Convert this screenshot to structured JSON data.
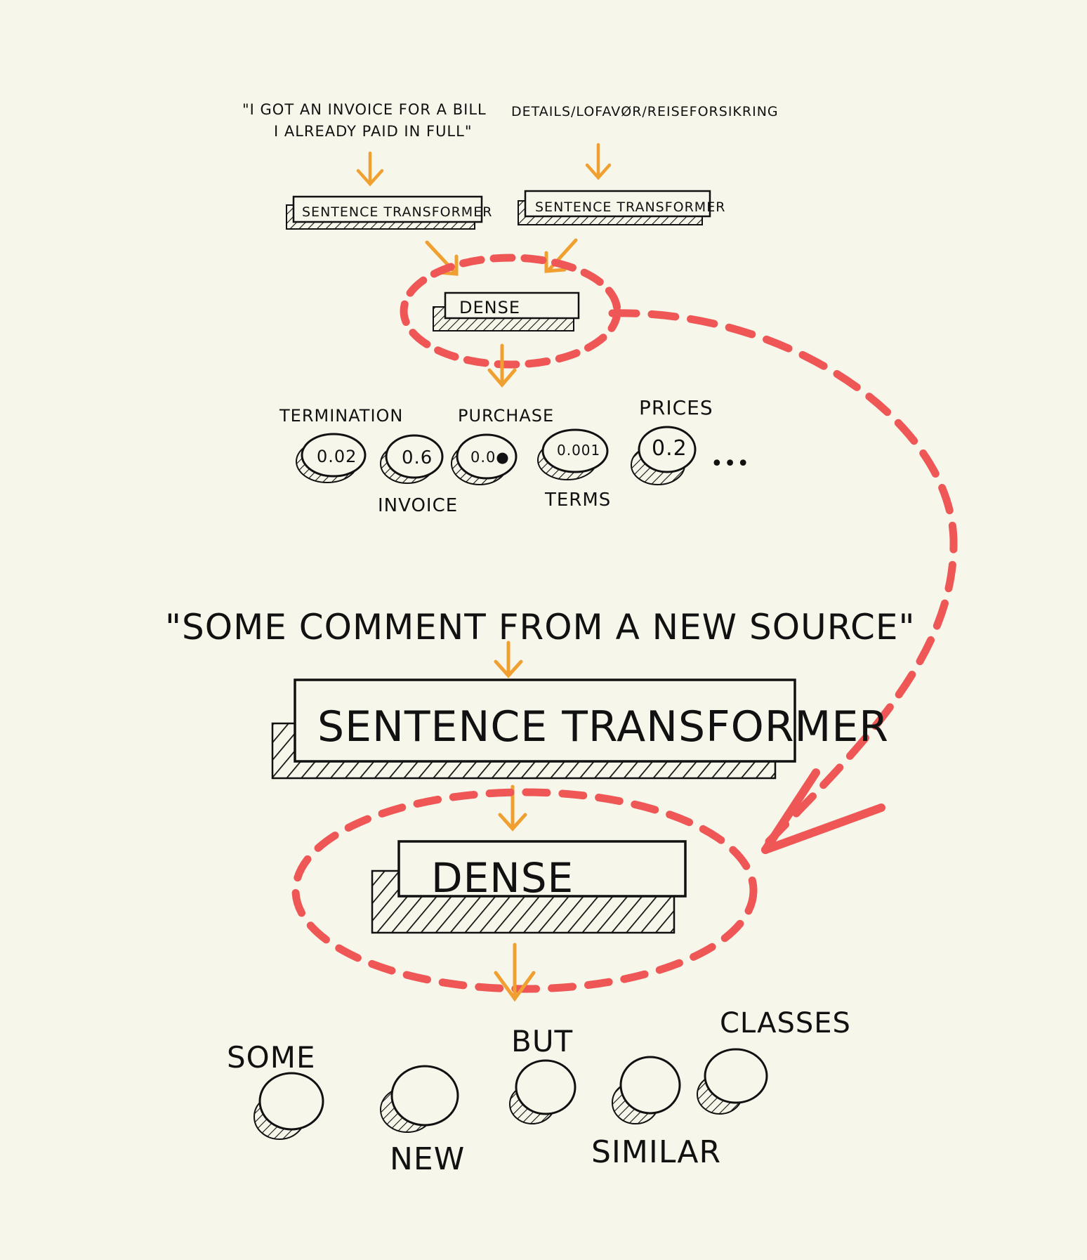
{
  "top": {
    "left_input_line1": "\"I GOT AN INVOICE FOR A BILL",
    "left_input_line2": "I ALREADY PAID IN FULL\"",
    "right_input": "DETAILS/LOFAVØR/REISEFORSIKRING",
    "left_transformer_label": "SENTENCE TRANSFORMER",
    "right_transformer_label": "SENTENCE TRANSFORMER",
    "dense_label": "DENSE",
    "classes": [
      {
        "value": "0.02",
        "label": "TERMINATION"
      },
      {
        "value": "0.6",
        "label": "INVOICE"
      },
      {
        "value": "0.0●",
        "label": "PURCHASE"
      },
      {
        "value": "0.001",
        "label": "TERMS"
      },
      {
        "value": "0.2",
        "label": "PRICES"
      }
    ],
    "ellipsis": "•••"
  },
  "bottom": {
    "input": "\"SOME COMMENT FROM A NEW SOURCE\"",
    "transformer_label": "SENTENCE TRANSFORMER",
    "dense_label": "DENSE",
    "classes": [
      {
        "label": "SOME"
      },
      {
        "label": "NEW"
      },
      {
        "label": "BUT"
      },
      {
        "label": "SIMILAR"
      },
      {
        "label": "CLASSES"
      }
    ]
  },
  "colors": {
    "ink": "#111111",
    "arrow": "#f0a030",
    "highlight": "#ef5656",
    "paper": "#f6f6ea"
  }
}
